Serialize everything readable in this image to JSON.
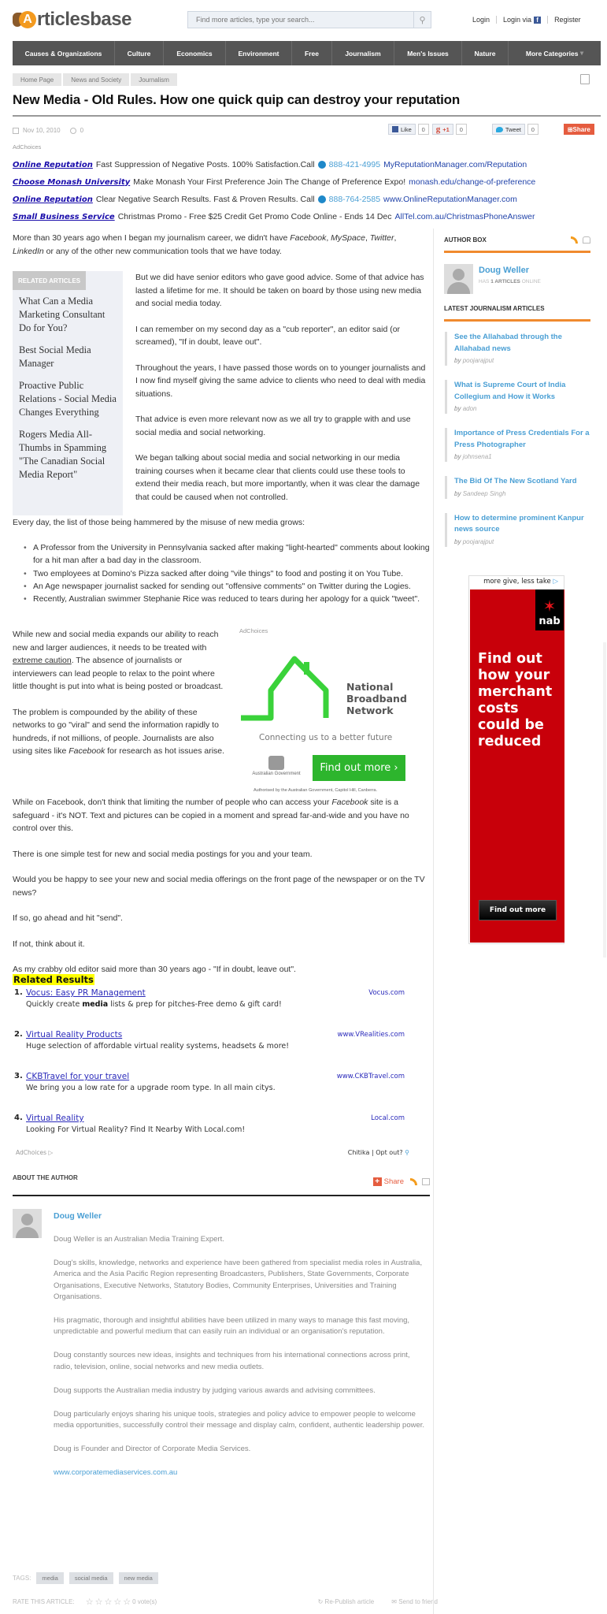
{
  "header": {
    "logo_text": "rticlesbase",
    "logo_letter": "A",
    "search_placeholder": "Find more articles, type your search...",
    "login": "Login",
    "login_via": "Login via",
    "register": "Register"
  },
  "nav": [
    "Causes & Organizations",
    "Culture",
    "Economics",
    "Environment",
    "Free",
    "Journalism",
    "Men's Issues",
    "Nature",
    "More Categories"
  ],
  "nav_more_arrow": "▾",
  "breadcrumb": [
    "Home Page",
    "News and Society",
    "Journalism"
  ],
  "article": {
    "title": "New Media - Old Rules. How one quick quip can destroy your reputation",
    "date": "Nov 10, 2010",
    "comments": "0",
    "social": {
      "like": "Like",
      "like_count": "0",
      "gplus": "+1",
      "gplus_count": "0",
      "tweet": "Tweet",
      "tweet_count": "0",
      "share": "Share"
    },
    "adchoices": "AdChoices"
  },
  "text_ads": [
    {
      "title": "Online Reputation",
      "desc": "Fast Suppression of Negative Posts. 100% Satisfaction.Call",
      "phone": "888-421-4995",
      "url": "MyReputationManager.com/Reputation"
    },
    {
      "title": "Choose Monash University",
      "desc": "Make Monash Your First Preference Join The Change of Preference Expo!",
      "phone": "",
      "url": "monash.edu/change-of-preference"
    },
    {
      "title": "Online Reputation",
      "desc": "Clear Negative Search Results. Fast & Proven Results. Call",
      "phone": "888-764-2585",
      "url": "www.OnlineReputationManager.com"
    },
    {
      "title": "Small Business Service",
      "desc": "Christmas Promo - Free $25 Credit Get Promo Code Online - Ends 14 Dec",
      "phone": "",
      "url": "AllTel.com.au/ChristmasPhoneAnswer"
    }
  ],
  "body": {
    "intro_a": "More than 30 years ago when I began my journalism career, we didn't have ",
    "intro_facebook": "Facebook",
    "intro_myspace": "MySpace",
    "intro_twitter": "Twitter",
    "intro_linkedin": "LinkedIn",
    "intro_b": " or any of the other new communication tools that we have today.",
    "p1": "But we did have senior editors who gave good advice. Some of that advice has lasted a lifetime for me. It should be taken on board by those using new media and social media today.",
    "p2": "I can remember on my second day as a \"cub reporter\", an editor said (or screamed), \"If in doubt, leave out\".",
    "p3": "Throughout the years, I have passed those words on to younger journalists and I now find myself giving the same advice to clients who need to deal with media situations.",
    "p4": "That advice is even more relevant now as we all try to grapple with and use social media and social networking.",
    "p5": "We began talking about social media and social networking in our media training courses when it became clear that clients could use these tools to extend their media reach, but more importantly, when it was clear the damage that could be caused when not controlled.",
    "every_day": "Every day, the list of those being hammered by the misuse of new media grows:",
    "bullets": [
      "A Professor from the University in Pennsylvania sacked after making \"light-hearted\" comments about looking for a hit man after a bad day in the classroom.",
      "Two employees at Domino's Pizza sacked after doing \"vile things\" to food and posting it on You Tube.",
      "An Age newspaper journalist sacked for sending out \"offensive comments\" on Twitter during the Logies.",
      "Recently, Australian swimmer Stephanie Rice was reduced to tears during her apology for a quick \"tweet\"."
    ],
    "p6_a": "While new and social media expands our ability to reach new and larger audiences, it needs to be treated with ",
    "p6_link": "extreme caution",
    "p6_b": ". The absence of journalists or interviewers can lead people to relax to the point where little thought is put into what is being posted or broadcast.",
    "p7_a": "The problem is compounded by the ability of these networks to go \"viral\" and send the information rapidly to hundreds, if not millions, of people. Journalists are also using sites like ",
    "p7_fb": "Facebook",
    "p7_b": " for research as hot issues arise.",
    "p8_a": "While on Facebook, don't think that limiting the number of people who can access your ",
    "p8_fb": "Facebook",
    "p8_b": " site is a safeguard - it's NOT. Text and pictures can be copied in a moment and spread far-and-wide and you have no control over this.",
    "p9": "There is one simple test for new and social media postings for you and your team.",
    "p10": "Would you be happy to see your new and social media offerings on the front page of the newspaper or on the TV news?",
    "p11": "If so, go ahead and hit \"send\".",
    "p12": "If not, think about it.",
    "p13": "As my crabby old editor said more than 30 years ago - \"If in doubt, leave out\"."
  },
  "related_articles": {
    "heading": "RELATED ARTICLES",
    "items": [
      "What Can a Media Marketing Consultant Do for You?",
      "Best Social Media Manager",
      "Proactive Public Relations - Social Media Changes Everything",
      "Rogers Media All-Thumbs in Spamming \"The Canadian Social Media Report\""
    ]
  },
  "nbn_ad": {
    "adchoices": "AdChoices",
    "title_1": "National",
    "title_2": "Broadband",
    "title_3": "Network",
    "tagline": "Connecting us to a better future",
    "gov": "Australian Government",
    "button": "Find out more ›",
    "auth": "Authorised by the Australian Government, Capitol Hill, Canberra."
  },
  "related_results": {
    "heading": "Related Results",
    "items": [
      {
        "num": "1.",
        "title": "Vocus: Easy PR Management",
        "desc_a": "Quickly create ",
        "desc_bold": "media",
        "desc_b": " lists & prep for pitches-Free demo & gift card!",
        "domain": "Vocus.com"
      },
      {
        "num": "2.",
        "title": "Virtual Reality Products",
        "desc_a": "Huge selection of affordable virtual reality systems, headsets & more!",
        "desc_bold": "",
        "desc_b": "",
        "domain": "www.VRealities.com"
      },
      {
        "num": "3.",
        "title": "CKBTravel for your travel",
        "desc_a": "We bring you a low rate for a upgrade room type. In all main citys.",
        "desc_bold": "",
        "desc_b": "",
        "domain": "www.CKBTravel.com"
      },
      {
        "num": "4.",
        "title": "Virtual Reality",
        "desc_a": "Looking For Virtual Reality? Find It Nearby With Local.com!",
        "desc_bold": "",
        "desc_b": "",
        "domain": "Local.com"
      }
    ],
    "adchoices": "AdChoices ▷",
    "chitika": "Chitika |",
    "opt_out": "Opt out?"
  },
  "about_author": {
    "heading": "ABOUT THE AUTHOR",
    "share": "Share",
    "name": "Doug Weller",
    "bio": [
      "Doug Weller is an Australian Media Training Expert.",
      "Doug's skills, knowledge, networks and experience have been gathered from specialist media roles in Australia, America and the Asia Pacific Region representing Broadcasters, Publishers, State Governments, Corporate Organisations, Executive Networks, Statutory Bodies, Community Enterprises, Universities and Training Organisations.",
      "His pragmatic, thorough and insightful abilities have been utilized in many ways to manage this fast moving, unpredictable and powerful medium that can easily ruin an individual or an organisation's reputation.",
      "Doug constantly sources new ideas, insights and techniques from his international connections across print, radio, television, online, social networks and new media outlets.",
      "Doug supports the Australian media industry by judging various awards and advising committees.",
      "Doug particularly enjoys sharing his unique tools, strategies and policy advice to empower people to welcome media opportunities, successfully control their message and display calm, confident, authentic leadership power.",
      "Doug is Founder and Director of Corporate Media Services."
    ],
    "website": "www.corporatemediaservices.com.au"
  },
  "tags": {
    "label": "TAGS:",
    "items": [
      "media",
      "social media",
      "new media"
    ]
  },
  "rating": {
    "label": "RATE THIS ARTICLE:",
    "stars": 0,
    "max_stars": 5,
    "votes": "0 vote(s)",
    "republish": "Re-Publish article",
    "send": "Send to friend"
  },
  "sidebar": {
    "author_box": {
      "heading": "AUTHOR BOX",
      "name": "Doug Weller",
      "has": "HAS",
      "count": "1 ARTICLES",
      "online": "ONLINE"
    },
    "latest": {
      "heading": "LATEST JOURNALISM ARTICLES",
      "items": [
        {
          "title": "See the Allahabad through the Allahabad news",
          "author": "poojarajput"
        },
        {
          "title": "What is Supreme Court of India Collegium and How it Works",
          "author": "adon"
        },
        {
          "title": "Importance of Press Credentials For a Press Photographer",
          "author": "johnsena1"
        },
        {
          "title": "The Bid Of The New Scotland Yard",
          "author": "Sandeep Singh"
        },
        {
          "title": "How to determine prominent Kanpur news source",
          "author": "poojarajput"
        }
      ],
      "by": "by"
    },
    "nab_ad": {
      "tagline": "more give, less take",
      "brand": "nab",
      "headline": [
        "Find out",
        "how your",
        "merchant",
        "costs",
        "could be",
        "reduced"
      ],
      "button": "Find out more"
    }
  },
  "colors": {
    "nav_bg": "#555555",
    "accent_orange": "#f08a2e",
    "link_blue": "#4a9fd4",
    "ad_red": "#c8000a",
    "nbn_green": "#2db52d"
  }
}
